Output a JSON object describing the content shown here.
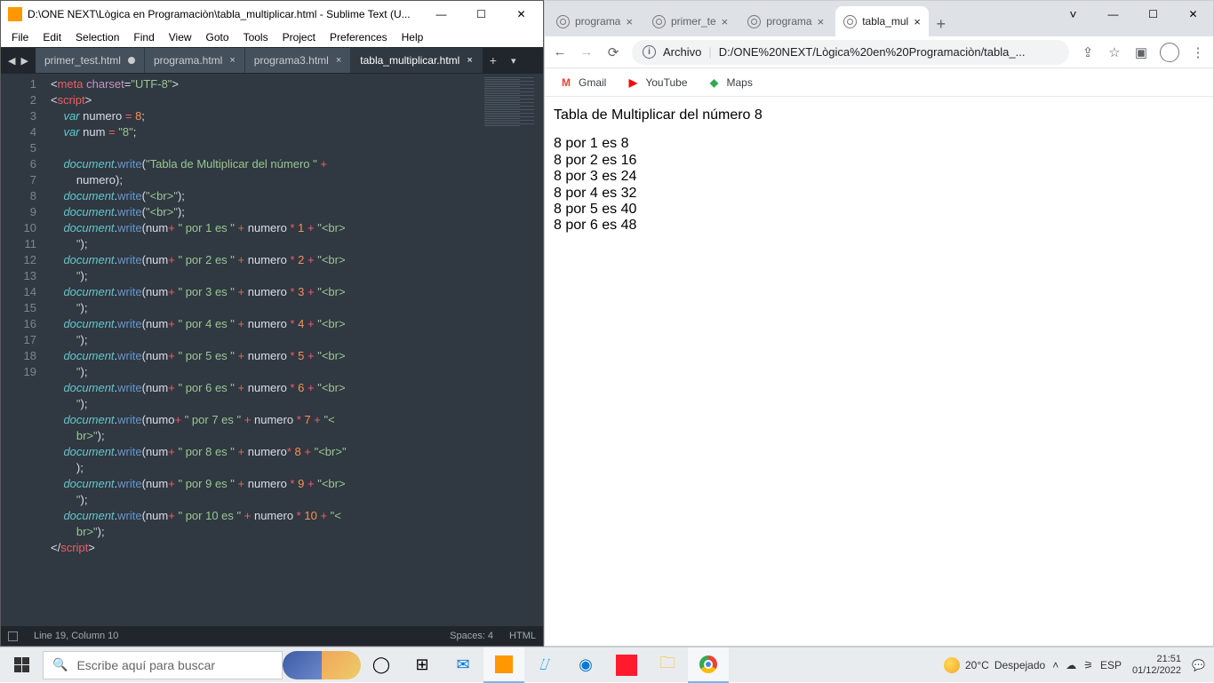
{
  "sublime": {
    "title": "D:\\ONE NEXT\\Lògica en Programaciòn\\tabla_multiplicar.html - Sublime Text (U...",
    "menu": [
      "File",
      "Edit",
      "Selection",
      "Find",
      "View",
      "Goto",
      "Tools",
      "Project",
      "Preferences",
      "Help"
    ],
    "tabs": [
      {
        "label": "primer_test.html",
        "dirty": true,
        "active": false
      },
      {
        "label": "programa.html",
        "dirty": false,
        "active": false
      },
      {
        "label": "programa3.html",
        "dirty": false,
        "active": false
      },
      {
        "label": "tabla_multiplicar.html",
        "dirty": false,
        "active": true
      }
    ],
    "line_numbers": [
      "1",
      "2",
      "3",
      "4",
      "5",
      "6",
      "",
      "7",
      "8",
      "9",
      "",
      "10",
      "",
      "11",
      "",
      "12",
      "",
      "13",
      "",
      "14",
      "",
      "15",
      "",
      "16",
      "",
      "17",
      "",
      "18",
      "",
      "19"
    ],
    "status": {
      "left": "Line 19, Column 10",
      "spaces": "Spaces: 4",
      "syntax": "HTML"
    }
  },
  "chrome": {
    "tabs": [
      {
        "label": "programa",
        "active": false
      },
      {
        "label": "primer_te",
        "active": false
      },
      {
        "label": "programa",
        "active": false
      },
      {
        "label": "tabla_mul",
        "active": true
      }
    ],
    "address": {
      "scheme": "Archivo",
      "path": "D:/ONE%20NEXT/Lògica%20en%20Programaciòn/tabla_..."
    },
    "bookmarks": [
      {
        "icon": "M",
        "color": "#ea4335",
        "label": "Gmail"
      },
      {
        "icon": "▶",
        "color": "#ff0000",
        "label": "YouTube"
      },
      {
        "icon": "◆",
        "color": "#34a853",
        "label": "Maps"
      }
    ],
    "page": {
      "title": "Tabla de Multiplicar del número 8",
      "lines": [
        "8 por 1 es 8",
        "8 por 2 es 16",
        "8 por 3 es 24",
        "8 por 4 es 32",
        "8 por 5 es 40",
        "8 por 6 es 48"
      ]
    }
  },
  "taskbar": {
    "search_placeholder": "Escribe aquí para buscar",
    "weather_temp": "20°C",
    "weather_desc": "Despejado",
    "lang": "ESP",
    "time": "21:51",
    "date": "01/12/2022"
  }
}
